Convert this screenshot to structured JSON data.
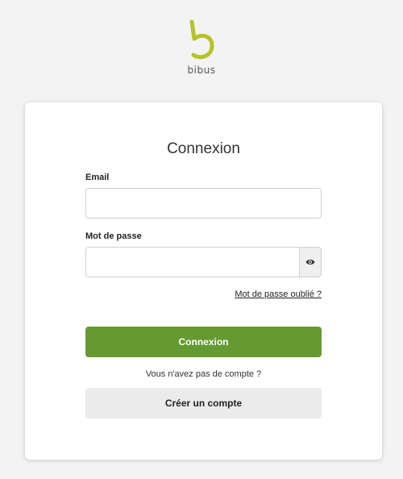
{
  "brand": {
    "name": "bibus",
    "accent_color": "#b5c22a"
  },
  "login": {
    "title": "Connexion",
    "email_label": "Email",
    "email_value": "",
    "password_label": "Mot de passe",
    "password_value": "",
    "toggle_password_icon": "eye-icon",
    "forgot_password_link": "Mot de passe oublié ?",
    "submit_label": "Connexion",
    "submit_color": "#659a31",
    "no_account_text": "Vous n'avez pas de compte ?",
    "create_account_label": "Créer un compte"
  }
}
